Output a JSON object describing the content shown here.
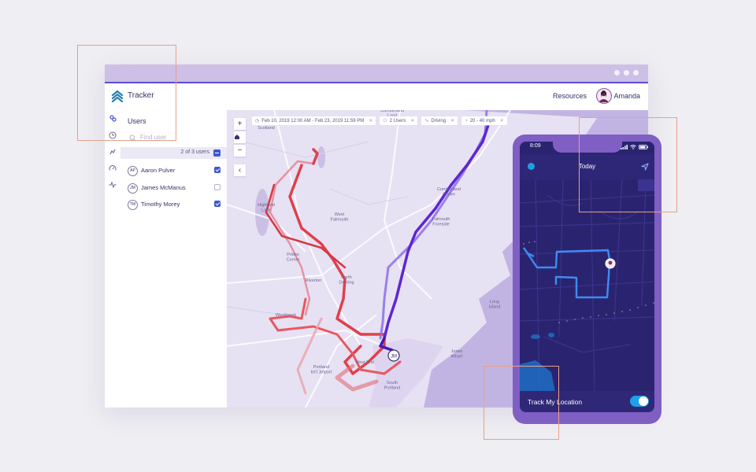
{
  "app": {
    "name": "Tracker",
    "resources_label": "Resources",
    "user_name": "Amanda"
  },
  "sidebar": {
    "title": "Users",
    "search_placeholder": "Find user",
    "selection_summary": "2 of 3 users",
    "users": [
      {
        "initials": "AP",
        "name": "Aaron Pulver",
        "checked": true
      },
      {
        "initials": "JM",
        "name": "James McManus",
        "checked": false
      },
      {
        "initials": "TM",
        "name": "Timothy Morey",
        "checked": true
      }
    ]
  },
  "filters": {
    "date_range": "Feb 10, 2019 12:00 AM - Feb 23, 2019 11:59 PM",
    "users": "2 Users",
    "activity": "Driving",
    "speed": "20 - 40 mph"
  },
  "map": {
    "zoom_in": "+",
    "zoom_out": "−",
    "collapse": "‹",
    "marker_label": "JM",
    "places": {
      "scotland": "Scotland",
      "highland_lake": "Highland\nLake",
      "west_falmouth": "West\nFalmouth",
      "cumberland_center": "Cumberland\nCenter",
      "cumberland_foreside": "Falmouth\nForeside",
      "prides_corner": "Prides\nCorner",
      "riverton": "Riverton",
      "north_deering": "North\nDeering",
      "westbrook": "Westbrook",
      "west_end": "West End",
      "portland_jetport": "Portland\nInt'l Jetport",
      "south_portland": "South\nPortland",
      "long_island": "Long\nIsland",
      "jones_wharf": "Jones\nWharf",
      "cumberland_land": "Cumberland\nLand"
    },
    "route_colors": {
      "red": "#e0404a",
      "purple": "#6a2fd8"
    }
  },
  "phone": {
    "time": "8:09",
    "title": "Today",
    "track_label": "Track My Location",
    "track_on": true,
    "route_color": "#3f8cf0"
  },
  "icons": {
    "logo": "tracker-logo-icon",
    "rail": [
      "users-icon",
      "history-icon",
      "signal-icon",
      "speedometer-icon",
      "activity-icon"
    ]
  },
  "colors": {
    "accent": "#3f57d0",
    "titlebar": "#cdbfe6",
    "phone_frame": "#7f5fc4",
    "map_land": "#e7e1f4",
    "map_water": "#c2b4e2"
  }
}
